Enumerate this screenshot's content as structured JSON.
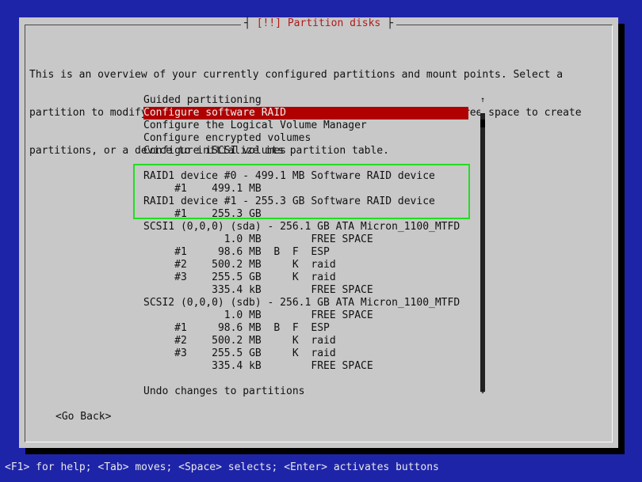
{
  "dialog": {
    "title_left": "┤ ",
    "title": "[!!] Partition disks",
    "title_right": " ├",
    "intro_lines": [
      "This is an overview of your currently configured partitions and mount points. Select a",
      "partition to modify its settings (file system, mount point, etc.), a free space to create",
      "partitions, or a device to initialize its partition table."
    ]
  },
  "menu": [
    {
      "label": "Guided partitioning",
      "selected": false
    },
    {
      "label": "Configure software RAID",
      "selected": true
    },
    {
      "label": "Configure the Logical Volume Manager",
      "selected": false
    },
    {
      "label": "Configure encrypted volumes",
      "selected": false
    },
    {
      "label": "Configure iSCSI volumes",
      "selected": false
    }
  ],
  "raid": [
    {
      "device": "RAID1 device #0 - 499.1 MB Software RAID device",
      "part": "#1",
      "size": "499.1 MB"
    },
    {
      "device": "RAID1 device #1 - 255.3 GB Software RAID device",
      "part": "#1",
      "size": "255.3 GB"
    }
  ],
  "disks": [
    {
      "header": "SCSI1 (0,0,0) (sda) - 256.1 GB ATA Micron_1100_MTFD",
      "rows": [
        {
          "num": "",
          "size": "1.0 MB",
          "flag1": "",
          "flag2": "",
          "type": "FREE SPACE"
        },
        {
          "num": "#1",
          "size": "98.6 MB",
          "flag1": "B",
          "flag2": "F",
          "type": "ESP"
        },
        {
          "num": "#2",
          "size": "500.2 MB",
          "flag1": "",
          "flag2": "K",
          "type": "raid"
        },
        {
          "num": "#3",
          "size": "255.5 GB",
          "flag1": "",
          "flag2": "K",
          "type": "raid"
        },
        {
          "num": "",
          "size": "335.4 kB",
          "flag1": "",
          "flag2": "",
          "type": "FREE SPACE"
        }
      ]
    },
    {
      "header": "SCSI2 (0,0,0) (sdb) - 256.1 GB ATA Micron_1100_MTFD",
      "rows": [
        {
          "num": "",
          "size": "1.0 MB",
          "flag1": "",
          "flag2": "",
          "type": "FREE SPACE"
        },
        {
          "num": "#1",
          "size": "98.6 MB",
          "flag1": "B",
          "flag2": "F",
          "type": "ESP"
        },
        {
          "num": "#2",
          "size": "500.2 MB",
          "flag1": "",
          "flag2": "K",
          "type": "raid"
        },
        {
          "num": "#3",
          "size": "255.5 GB",
          "flag1": "",
          "flag2": "K",
          "type": "raid"
        },
        {
          "num": "",
          "size": "335.4 kB",
          "flag1": "",
          "flag2": "",
          "type": "FREE SPACE"
        }
      ]
    }
  ],
  "undo_label": "Undo changes to partitions",
  "scroll_up": "↑",
  "scroll_down": "↓",
  "go_back_label": "<Go Back>",
  "status_bar": "<F1> for help; <Tab> moves; <Space> selects; <Enter> activates buttons",
  "colors": {
    "background": "#1e24a8",
    "dialog": "#c8c8c8",
    "selected": "#b00000",
    "title_text": "#b01a1a",
    "highlight_box": "#22dd22"
  }
}
